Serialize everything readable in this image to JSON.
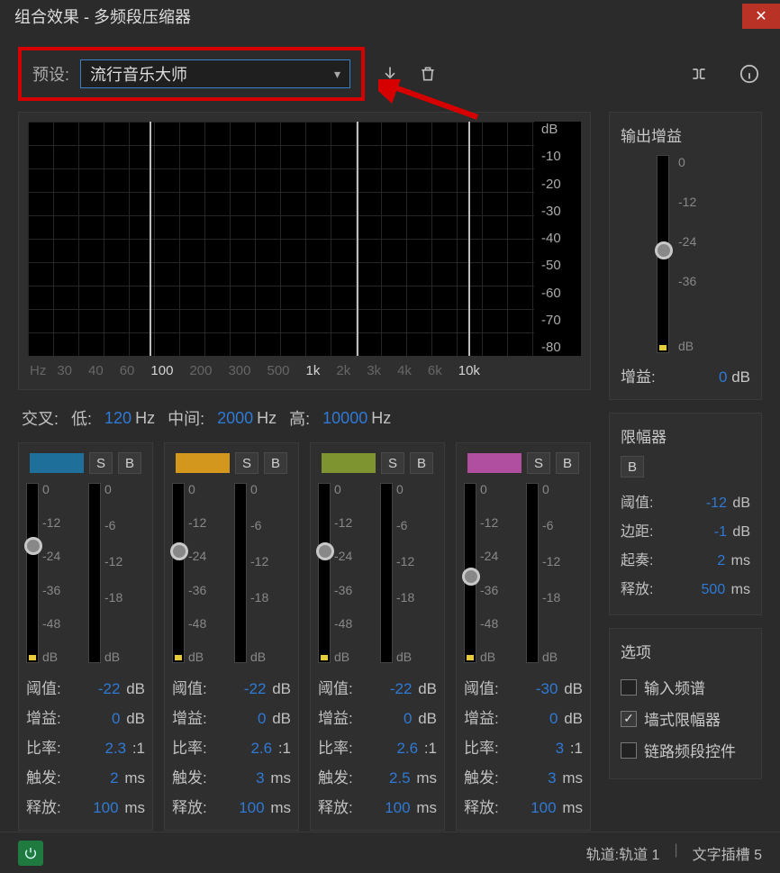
{
  "window": {
    "title": "组合效果 - 多频段压缩器"
  },
  "preset": {
    "label": "预设:",
    "value": "流行音乐大师"
  },
  "spectrum": {
    "db_ticks": [
      "dB",
      "-10",
      "-20",
      "-30",
      "-40",
      "-50",
      "-60",
      "-70",
      "-80"
    ],
    "hz_ticks": [
      {
        "t": "Hz",
        "b": false
      },
      {
        "t": "30",
        "b": false
      },
      {
        "t": "40",
        "b": false
      },
      {
        "t": "60",
        "b": false
      },
      {
        "t": "100",
        "b": true
      },
      {
        "t": "200",
        "b": false
      },
      {
        "t": "300",
        "b": false
      },
      {
        "t": "500",
        "b": false
      },
      {
        "t": "1k",
        "b": true
      },
      {
        "t": "2k",
        "b": false
      },
      {
        "t": "3k",
        "b": false
      },
      {
        "t": "4k",
        "b": false
      },
      {
        "t": "6k",
        "b": false
      },
      {
        "t": "10k",
        "b": true
      }
    ]
  },
  "crossover": {
    "label": "交叉:",
    "low_label": "低:",
    "low_value": "120",
    "low_unit": "Hz",
    "mid_label": "中间:",
    "mid_value": "2000",
    "mid_unit": "Hz",
    "high_label": "高:",
    "high_value": "10000",
    "high_unit": "Hz"
  },
  "band_ticks_left": [
    "0",
    "-12",
    "-24",
    "-36",
    "-48",
    "dB"
  ],
  "band_ticks_right": [
    "0",
    "-6",
    "-12",
    "-18",
    "",
    "dB"
  ],
  "bands": [
    {
      "S": "S",
      "B": "B",
      "knob_pct": 35,
      "threshold_label": "阈值:",
      "threshold_v": "-22",
      "threshold_u": "dB",
      "gain_label": "增益:",
      "gain_v": "0",
      "gain_u": "dB",
      "ratio_label": "比率:",
      "ratio_v": "2.3",
      "ratio_u": ":1",
      "attack_label": "触发:",
      "attack_v": "2",
      "attack_u": "ms",
      "release_label": "释放:",
      "release_v": "100",
      "release_u": "ms"
    },
    {
      "S": "S",
      "B": "B",
      "knob_pct": 38,
      "threshold_label": "阈值:",
      "threshold_v": "-22",
      "threshold_u": "dB",
      "gain_label": "增益:",
      "gain_v": "0",
      "gain_u": "dB",
      "ratio_label": "比率:",
      "ratio_v": "2.6",
      "ratio_u": ":1",
      "attack_label": "触发:",
      "attack_v": "3",
      "attack_u": "ms",
      "release_label": "释放:",
      "release_v": "100",
      "release_u": "ms"
    },
    {
      "S": "S",
      "B": "B",
      "knob_pct": 38,
      "threshold_label": "阈值:",
      "threshold_v": "-22",
      "threshold_u": "dB",
      "gain_label": "增益:",
      "gain_v": "0",
      "gain_u": "dB",
      "ratio_label": "比率:",
      "ratio_v": "2.6",
      "ratio_u": ":1",
      "attack_label": "触发:",
      "attack_v": "2.5",
      "attack_u": "ms",
      "release_label": "释放:",
      "release_v": "100",
      "release_u": "ms"
    },
    {
      "S": "S",
      "B": "B",
      "knob_pct": 52,
      "threshold_label": "阈值:",
      "threshold_v": "-30",
      "threshold_u": "dB",
      "gain_label": "增益:",
      "gain_v": "0",
      "gain_u": "dB",
      "ratio_label": "比率:",
      "ratio_v": "3",
      "ratio_u": ":1",
      "attack_label": "触发:",
      "attack_v": "3",
      "attack_u": "ms",
      "release_label": "释放:",
      "release_v": "100",
      "release_u": "ms"
    }
  ],
  "output_gain": {
    "title": "输出增益",
    "ticks": [
      "0",
      "-12",
      "-24",
      "-36",
      "",
      "dB"
    ],
    "knob_pct": 48,
    "gain_label": "增益:",
    "gain_v": "0",
    "gain_u": "dB"
  },
  "limiter": {
    "title": "限幅器",
    "B": "B",
    "threshold_label": "阈值:",
    "threshold_v": "-12",
    "threshold_u": "dB",
    "margin_label": "边距:",
    "margin_v": "-1",
    "margin_u": "dB",
    "attack_label": "起奏:",
    "attack_v": "2",
    "attack_u": "ms",
    "release_label": "释放:",
    "release_v": "500",
    "release_u": "ms"
  },
  "options": {
    "title": "选项",
    "spectrum_label": "输入频谱",
    "spectrum_checked": false,
    "brickwall_label": "墙式限幅器",
    "brickwall_checked": true,
    "link_label": "链路频段控件",
    "link_checked": false
  },
  "footer": {
    "track_label": "轨道:",
    "track_value": "轨道 1",
    "slot_label": "文字插槽",
    "slot_value": "5"
  }
}
